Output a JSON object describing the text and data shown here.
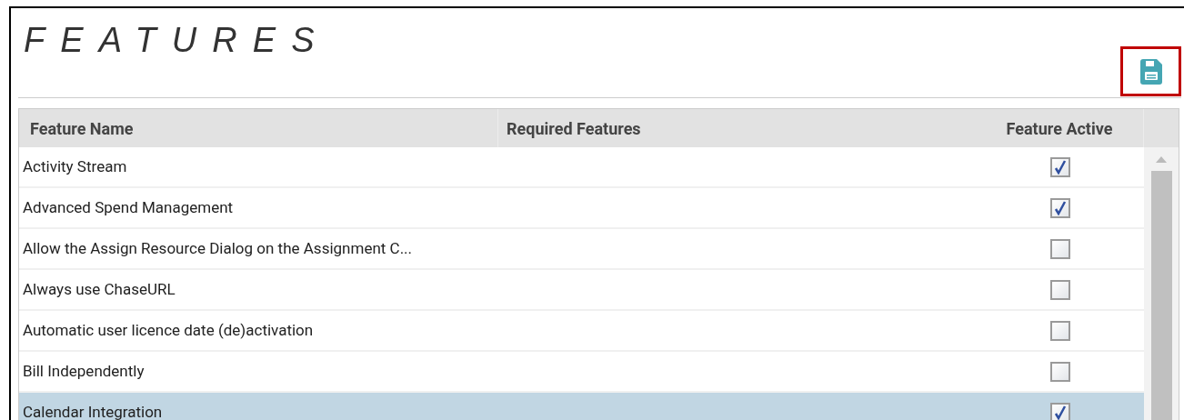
{
  "title": "FEATURES",
  "table": {
    "columns": [
      "Feature Name",
      "Required Features",
      "Feature Active"
    ],
    "rows": [
      {
        "name": "Activity Stream",
        "active": true,
        "selected": false
      },
      {
        "name": "Advanced Spend Management",
        "active": true,
        "selected": false
      },
      {
        "name": "Allow the Assign Resource Dialog on the Assignment C...",
        "active": false,
        "selected": false
      },
      {
        "name": "Always use ChaseURL",
        "active": false,
        "selected": false
      },
      {
        "name": "Automatic user licence date (de)activation",
        "active": false,
        "selected": false
      },
      {
        "name": "Bill Independently",
        "active": false,
        "selected": false
      },
      {
        "name": "Calendar Integration",
        "active": true,
        "selected": true
      }
    ]
  }
}
